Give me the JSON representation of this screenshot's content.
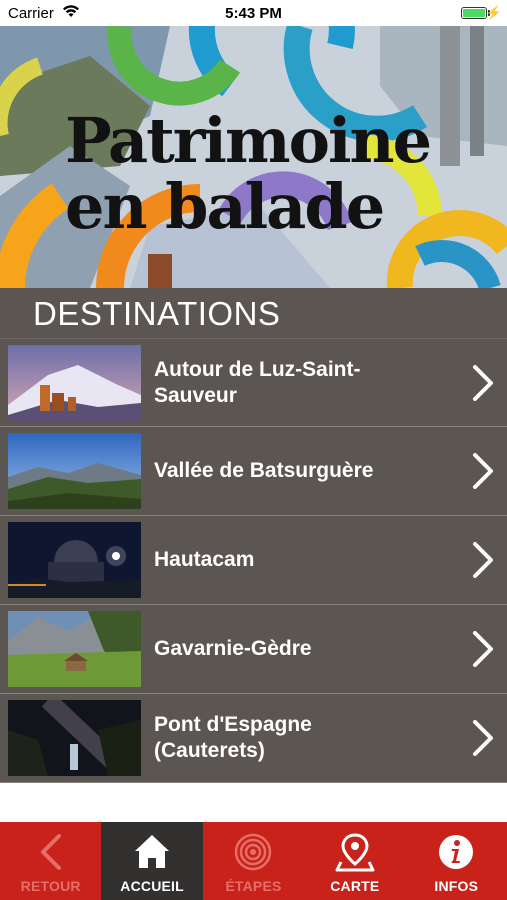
{
  "status_bar": {
    "carrier": "Carrier",
    "time": "5:43 PM",
    "battery_level": 1.0
  },
  "hero": {
    "title_line1": "Patrimoine",
    "title_line2": "en balade"
  },
  "destinations": {
    "heading": "DESTINATIONS",
    "items": [
      {
        "label_line1": "Autour de Luz-Saint-",
        "label_line2": "Sauveur",
        "thumbnail": "mountain-castle-dusk-photo"
      },
      {
        "label_line1": "Vallée de Batsurguère",
        "label_line2": "",
        "thumbnail": "valley-panorama-photo"
      },
      {
        "label_line1": "Hautacam",
        "label_line2": "",
        "thumbnail": "observatory-night-photo"
      },
      {
        "label_line1": "Gavarnie-Gèdre",
        "label_line2": "",
        "thumbnail": "alpine-meadow-hut-photo"
      },
      {
        "label_line1": "Pont d'Espagne",
        "label_line2": "(Cauterets)",
        "thumbnail": "milky-way-waterfall-photo"
      }
    ]
  },
  "tab_bar": {
    "tabs": [
      {
        "label": "RETOUR",
        "icon": "back-chevron-icon",
        "state": "disabled"
      },
      {
        "label": "ACCUEIL",
        "icon": "home-icon",
        "state": "active"
      },
      {
        "label": "ÉTAPES",
        "icon": "target-icon",
        "state": "disabled"
      },
      {
        "label": "CARTE",
        "icon": "map-pin-icon",
        "state": "enabled"
      },
      {
        "label": "INFOS",
        "icon": "info-icon",
        "state": "enabled"
      }
    ]
  },
  "colors": {
    "tab_bar": "#c9221b",
    "tab_active": "#333030",
    "panel": "#5c5652",
    "text_light": "#ffffff",
    "disabled_label": "#e56f68"
  }
}
